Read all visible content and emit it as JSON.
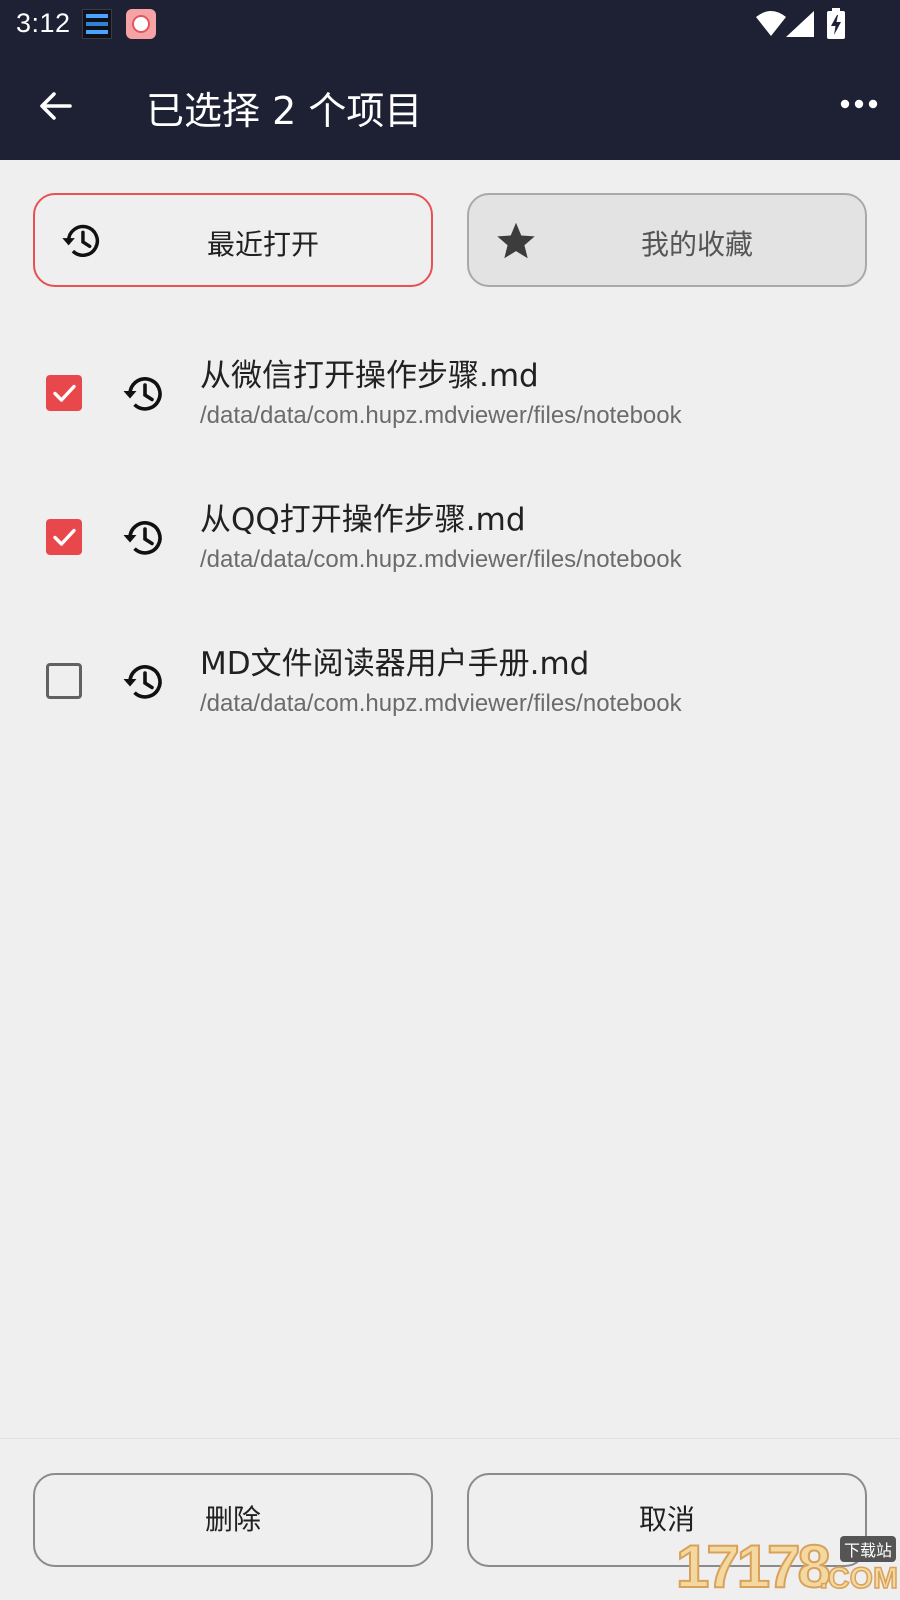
{
  "status_bar": {
    "time": "3:12"
  },
  "app_bar": {
    "title": "已选择 2 个项目"
  },
  "tabs": {
    "recent_label": "最近打开",
    "favorites_label": "我的收藏"
  },
  "files": [
    {
      "name": "从微信打开操作步骤.md",
      "path": "/data/data/com.hupz.mdviewer/files/notebook",
      "checked": true
    },
    {
      "name": "从QQ打开操作步骤.md",
      "path": "/data/data/com.hupz.mdviewer/files/notebook",
      "checked": true
    },
    {
      "name": "MD文件阅读器用户手册.md",
      "path": "/data/data/com.hupz.mdviewer/files/notebook",
      "checked": false
    }
  ],
  "actions": {
    "delete_label": "删除",
    "cancel_label": "取消"
  },
  "watermark": {
    "number": "17178",
    "tag": "下载站",
    "suffix": ".COM"
  },
  "colors": {
    "app_bar": "#1e2033",
    "accent": "#e8484c",
    "background": "#efeff0"
  },
  "icons": {
    "back": "arrow-left-icon",
    "more": "more-horizontal-icon",
    "recent": "history-icon",
    "favorite": "star-icon",
    "check": "check-icon"
  }
}
